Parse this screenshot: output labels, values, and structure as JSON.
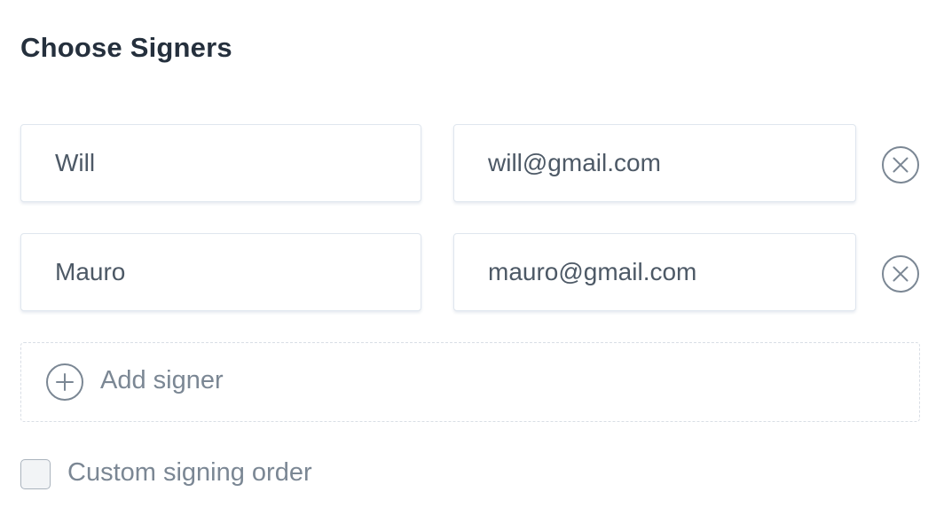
{
  "title": "Choose Signers",
  "signers": [
    {
      "name": "Will",
      "email": "will@gmail.com"
    },
    {
      "name": "Mauro",
      "email": "mauro@gmail.com"
    }
  ],
  "remove_icon": "circle-x-icon",
  "add_signer": {
    "label": "Add signer",
    "icon": "circle-plus-icon"
  },
  "custom_order": {
    "label": "Custom signing order",
    "checked": false
  },
  "colors": {
    "title": "#25303d",
    "field_text": "#4d5966",
    "muted_text": "#7b8794",
    "border": "#dfe6ee",
    "icon": "#7b8794"
  }
}
